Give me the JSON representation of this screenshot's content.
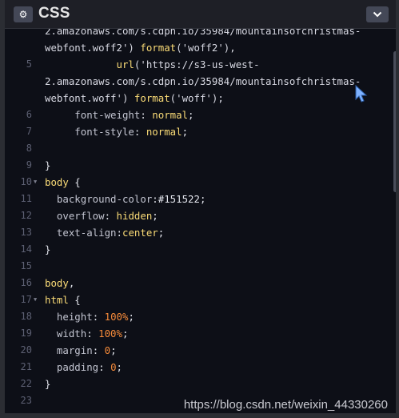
{
  "header": {
    "title": "CSS",
    "settings_icon": "gear-icon",
    "collapse_icon": "chevron-down-icon"
  },
  "colors": {
    "editor_bg": "#0d0f17",
    "header_bg": "#1e1f26",
    "button_bg": "#444857",
    "keyword": "#fbdc77",
    "number": "#f78b3a"
  },
  "lines": [
    {
      "ln": "",
      "fold": false,
      "parts": [
        {
          "t": "2.amazonaws.com/s.cdpn.io/35984/mountainsofchristmas-",
          "c": "t-str"
        }
      ]
    },
    {
      "ln": "",
      "fold": false,
      "parts": [
        {
          "t": "webfont.woff2') ",
          "c": "t-str"
        },
        {
          "t": "format",
          "c": "t-yellow"
        },
        {
          "t": "('woff2'),",
          "c": "t-str"
        }
      ]
    },
    {
      "ln": "5",
      "fold": false,
      "parts": [
        {
          "t": "            url",
          "c": "t-yellow"
        },
        {
          "t": "('https://s3-us-west-",
          "c": "t-str"
        }
      ]
    },
    {
      "ln": "",
      "fold": false,
      "parts": [
        {
          "t": "2.amazonaws.com/s.cdpn.io/35984/mountainsofchristmas-",
          "c": "t-str"
        }
      ]
    },
    {
      "ln": "",
      "fold": false,
      "parts": [
        {
          "t": "webfont.woff') ",
          "c": "t-str"
        },
        {
          "t": "format",
          "c": "t-yellow"
        },
        {
          "t": "('woff');",
          "c": "t-str"
        }
      ]
    },
    {
      "ln": "6",
      "fold": false,
      "parts": [
        {
          "t": "     font-weight",
          "c": "t-prop"
        },
        {
          "t": ": ",
          "c": "t-white"
        },
        {
          "t": "normal",
          "c": "t-yellow"
        },
        {
          "t": ";",
          "c": "t-white"
        }
      ]
    },
    {
      "ln": "7",
      "fold": false,
      "parts": [
        {
          "t": "     font-style",
          "c": "t-prop"
        },
        {
          "t": ": ",
          "c": "t-white"
        },
        {
          "t": "normal",
          "c": "t-yellow"
        },
        {
          "t": ";",
          "c": "t-white"
        }
      ]
    },
    {
      "ln": "8",
      "fold": false,
      "parts": []
    },
    {
      "ln": "9",
      "fold": false,
      "parts": [
        {
          "t": "}",
          "c": "t-white"
        }
      ]
    },
    {
      "ln": "10",
      "fold": true,
      "parts": [
        {
          "t": "body",
          "c": "t-yellow"
        },
        {
          "t": " {",
          "c": "t-white"
        }
      ]
    },
    {
      "ln": "11",
      "fold": false,
      "parts": [
        {
          "t": "  background-color",
          "c": "t-prop"
        },
        {
          "t": ":#151522;",
          "c": "t-white"
        }
      ]
    },
    {
      "ln": "12",
      "fold": false,
      "parts": [
        {
          "t": "  overflow",
          "c": "t-prop"
        },
        {
          "t": ": ",
          "c": "t-white"
        },
        {
          "t": "hidden",
          "c": "t-yellow"
        },
        {
          "t": ";",
          "c": "t-white"
        }
      ]
    },
    {
      "ln": "13",
      "fold": false,
      "parts": [
        {
          "t": "  text-align",
          "c": "t-prop"
        },
        {
          "t": ":",
          "c": "t-white"
        },
        {
          "t": "center",
          "c": "t-yellow"
        },
        {
          "t": ";",
          "c": "t-white"
        }
      ]
    },
    {
      "ln": "14",
      "fold": false,
      "parts": [
        {
          "t": "}",
          "c": "t-white"
        }
      ]
    },
    {
      "ln": "15",
      "fold": false,
      "parts": []
    },
    {
      "ln": "16",
      "fold": false,
      "parts": [
        {
          "t": "body",
          "c": "t-yellow"
        },
        {
          "t": ",",
          "c": "t-white"
        }
      ]
    },
    {
      "ln": "17",
      "fold": true,
      "parts": [
        {
          "t": "html",
          "c": "t-yellow"
        },
        {
          "t": " {",
          "c": "t-white"
        }
      ]
    },
    {
      "ln": "18",
      "fold": false,
      "parts": [
        {
          "t": "  height",
          "c": "t-prop"
        },
        {
          "t": ": ",
          "c": "t-white"
        },
        {
          "t": "100%",
          "c": "t-num"
        },
        {
          "t": ";",
          "c": "t-white"
        }
      ]
    },
    {
      "ln": "19",
      "fold": false,
      "parts": [
        {
          "t": "  width",
          "c": "t-prop"
        },
        {
          "t": ": ",
          "c": "t-white"
        },
        {
          "t": "100%",
          "c": "t-num"
        },
        {
          "t": ";",
          "c": "t-white"
        }
      ]
    },
    {
      "ln": "20",
      "fold": false,
      "parts": [
        {
          "t": "  margin",
          "c": "t-prop"
        },
        {
          "t": ": ",
          "c": "t-white"
        },
        {
          "t": "0",
          "c": "t-num"
        },
        {
          "t": ";",
          "c": "t-white"
        }
      ]
    },
    {
      "ln": "21",
      "fold": false,
      "parts": [
        {
          "t": "  padding",
          "c": "t-prop"
        },
        {
          "t": ": ",
          "c": "t-white"
        },
        {
          "t": "0",
          "c": "t-num"
        },
        {
          "t": ";",
          "c": "t-white"
        }
      ]
    },
    {
      "ln": "22",
      "fold": false,
      "parts": [
        {
          "t": "}",
          "c": "t-white"
        }
      ]
    },
    {
      "ln": "23",
      "fold": false,
      "parts": []
    }
  ],
  "watermark": "https://blog.csdn.net/weixin_44330260"
}
